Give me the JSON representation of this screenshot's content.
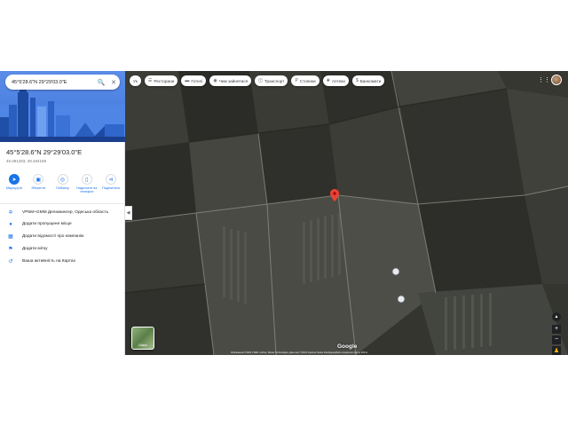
{
  "search": {
    "query": "45°5'28.6\"N 29°29'03.0\"E"
  },
  "place": {
    "title": "45°5'28.6\"N 29°29'03.0\"E",
    "decimal": "45.091283, 29.484159"
  },
  "actions": [
    {
      "label": "Маршрути",
      "icon": "directions-icon"
    },
    {
      "label": "Зберегти",
      "icon": "bookmark-icon"
    },
    {
      "label": "Поблизу",
      "icon": "nearby-icon"
    },
    {
      "label": "Надіслати на телефон",
      "icon": "phone-icon"
    },
    {
      "label": "Поділитися",
      "icon": "share-icon"
    }
  ],
  "info_rows": [
    {
      "icon": "plus-code-icon",
      "text": "VP5M+GMM Делюжингер, Одеська область"
    },
    {
      "icon": "pin-icon",
      "text": "Додати пропущене місце"
    },
    {
      "icon": "business-icon",
      "text": "Додати відомості про компанію"
    },
    {
      "icon": "label-icon",
      "text": "Додати мітку"
    },
    {
      "icon": "history-icon",
      "text": "Ваша активність на Картах"
    }
  ],
  "map": {
    "language_button": "Ук",
    "chips": [
      {
        "label": "Ресторани",
        "icon": "fork-icon"
      },
      {
        "label": "Готелі",
        "icon": "bed-icon"
      },
      {
        "label": "Чим зайнятися",
        "icon": "camera-icon"
      },
      {
        "label": "Транспорт",
        "icon": "bus-icon"
      },
      {
        "label": "Стоянки",
        "icon": "parking-icon"
      },
      {
        "label": "Аптеки",
        "icon": "pharmacy-icon"
      },
      {
        "label": "Банкомати",
        "icon": "atm-icon"
      }
    ],
    "layers_label": "Шари",
    "google_logo": "Google",
    "attribution": "Зображення ©2023 CNES / Airbus, Maxar Technologies, Дані карт ©2023  Україна  Умови  Конфіденційність  Надіслати відгук  200 м",
    "pin_color": "#ea4335",
    "accent": "#1a73e8"
  }
}
